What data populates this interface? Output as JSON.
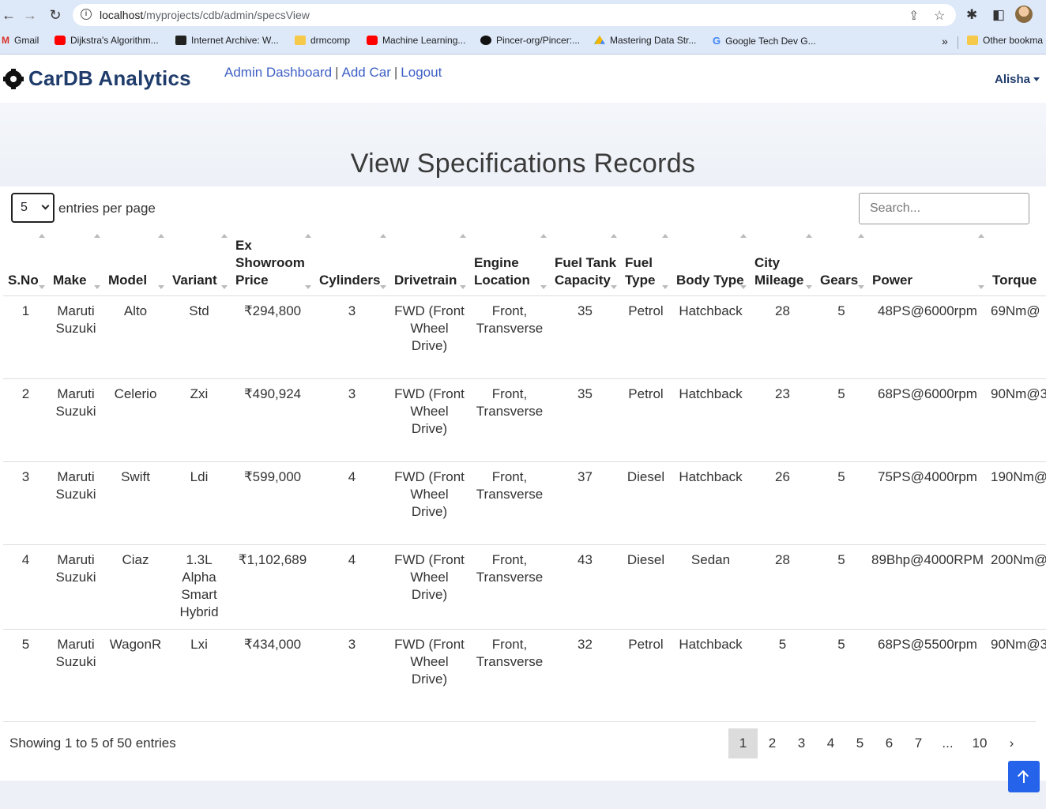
{
  "browser": {
    "url_host": "localhost",
    "url_path": "/myprojects/cdb/admin/specsView",
    "bookmarks": [
      {
        "label": "Gmail",
        "icon": "gmail-icon"
      },
      {
        "label": "Dijkstra's Algorithm...",
        "icon": "youtube-icon"
      },
      {
        "label": "Internet Archive: W...",
        "icon": "internet-archive-icon"
      },
      {
        "label": "drmcomp",
        "icon": "folder-icon"
      },
      {
        "label": "Machine Learning...",
        "icon": "youtube-icon"
      },
      {
        "label": "Pincer-org/Pincer:...",
        "icon": "github-icon"
      },
      {
        "label": "Mastering Data Str...",
        "icon": "google-drive-icon"
      },
      {
        "label": "Google Tech Dev G...",
        "icon": "google-icon"
      }
    ],
    "overflow_label": "»",
    "other_bookmarks": "Other bookma"
  },
  "navbar": {
    "brand": "CarDB Analytics",
    "links": [
      "Admin Dashboard",
      "Add Car",
      "Logout"
    ],
    "separator": "|",
    "user": "Alisha"
  },
  "page": {
    "title": "View Specifications Records",
    "per_page_value": "5",
    "per_page_label": "entries per page",
    "search_placeholder": "Search..."
  },
  "table": {
    "headers": [
      "S.No",
      "Make",
      "Model",
      "Variant",
      "Ex Showroom Price",
      "Cylinders",
      "Drivetrain",
      "Engine Location",
      "Fuel Tank Capacity",
      "Fuel Type",
      "Body Type",
      "City Mileage",
      "Gears",
      "Power",
      "Torque"
    ],
    "rows": [
      [
        "1",
        "Maruti Suzuki",
        "Alto",
        "Std",
        "₹294,800",
        "3",
        "FWD (Front Wheel Drive)",
        "Front, Transverse",
        "35",
        "Petrol",
        "Hatchback",
        "28",
        "5",
        "48PS@6000rpm",
        "69Nm@"
      ],
      [
        "2",
        "Maruti Suzuki",
        "Celerio",
        "Zxi",
        "₹490,924",
        "3",
        "FWD (Front Wheel Drive)",
        "Front, Transverse",
        "35",
        "Petrol",
        "Hatchback",
        "23",
        "5",
        "68PS@6000rpm",
        "90Nm@3"
      ],
      [
        "3",
        "Maruti Suzuki",
        "Swift",
        "Ldi",
        "₹599,000",
        "4",
        "FWD (Front Wheel Drive)",
        "Front, Transverse",
        "37",
        "Diesel",
        "Hatchback",
        "26",
        "5",
        "75PS@4000rpm",
        "190Nm@"
      ],
      [
        "4",
        "Maruti Suzuki",
        "Ciaz",
        "1.3L Alpha Smart Hybrid",
        "₹1,102,689",
        "4",
        "FWD (Front Wheel Drive)",
        "Front, Transverse",
        "43",
        "Diesel",
        "Sedan",
        "28",
        "5",
        "89Bhp@4000RPM",
        "200Nm@"
      ],
      [
        "5",
        "Maruti Suzuki",
        "WagonR",
        "Lxi",
        "₹434,000",
        "3",
        "FWD (Front Wheel Drive)",
        "Front, Transverse",
        "32",
        "Petrol",
        "Hatchback",
        "5",
        "5",
        "68PS@5500rpm",
        "90Nm@3"
      ]
    ]
  },
  "footer": {
    "showing": "Showing 1 to 5 of 50 entries",
    "pages": [
      "1",
      "2",
      "3",
      "4",
      "5",
      "6",
      "7",
      "...",
      "10",
      "›"
    ],
    "active_page": "1"
  },
  "colors": {
    "brand": "#1f3c6b",
    "link": "#3d5fc4",
    "scroll_top_button": "#2563eb"
  }
}
